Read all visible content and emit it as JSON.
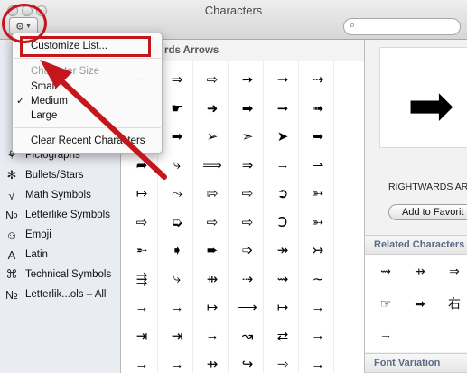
{
  "window": {
    "title": "Characters",
    "action_icon": "gear-icon",
    "search_placeholder": ""
  },
  "sidebar": {
    "items": [
      {
        "icon": "⚘",
        "label": "Pictographs"
      },
      {
        "icon": "✻",
        "label": "Bullets/Stars"
      },
      {
        "icon": "√",
        "label": "Math Symbols"
      },
      {
        "icon": "№",
        "label": "Letterlike Symbols"
      },
      {
        "icon": "☺",
        "label": "Emoji"
      },
      {
        "icon": "A",
        "label": "Latin"
      },
      {
        "icon": "⌘",
        "label": "Technical Symbols"
      },
      {
        "icon": "№",
        "label": "Letterlik...ols – All"
      }
    ]
  },
  "grid": {
    "header": "Rightwards Arrows",
    "header_visible": "rds Arrows",
    "rows": [
      [
        "➛",
        "⇒",
        "⇨",
        "➙",
        "➝",
        "⇢"
      ],
      [
        "☞",
        "☛",
        "➜",
        "➡",
        "➞",
        "➟"
      ],
      [
        "➠",
        "➡",
        "➢",
        "➣",
        "➤",
        "➥"
      ],
      [
        "➦",
        "⤷",
        "⟹",
        "⇒",
        "→",
        "⇀"
      ],
      [
        "↦",
        "⤳",
        "⇰",
        "⇨",
        "➲",
        "➳"
      ],
      [
        "⇨",
        "➭",
        "⇨",
        "⇨",
        "Ↄ",
        "➳"
      ],
      [
        "➵",
        "➧",
        "➨",
        "➩",
        "↠",
        "↣"
      ],
      [
        "⇶",
        "⤷",
        "⇻",
        "⇢",
        "⇝",
        "∼"
      ],
      [
        "→",
        "→",
        "↦",
        "⟶",
        "↦",
        "→"
      ],
      [
        "⇥",
        "⇥",
        "→",
        "↝",
        "⇄",
        "→"
      ],
      [
        "→",
        "→",
        "⇸",
        "↪",
        "⇾",
        "→"
      ]
    ]
  },
  "detail": {
    "preview_glyph": "➡",
    "char_name": "RIGHTWARDS AR",
    "fav_button": "Add to Favorit",
    "related_header": "Related Characters",
    "related": [
      "⇝",
      "⇸",
      "⇒",
      "☞",
      "➡",
      "右",
      "→"
    ],
    "font_header": "Font Variation"
  },
  "menu": {
    "customize": "Customize List...",
    "size_header": "Character Size",
    "small": "Small",
    "medium": "Medium",
    "large": "Large",
    "checkmark": "✓",
    "clear": "Clear Recent Characters"
  }
}
